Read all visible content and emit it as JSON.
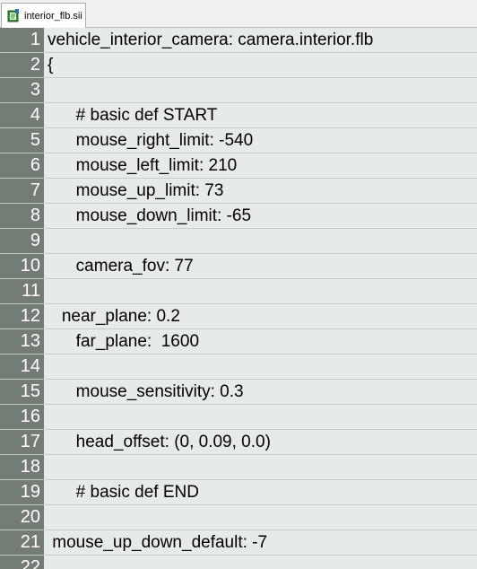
{
  "tab": {
    "icon": "notepad-file-icon",
    "label": "interior_flb.sii"
  },
  "colors": {
    "gutter": "#737d75",
    "editor_bg": "#e6ebe7",
    "line_separator": "#c3ccc5",
    "line_number_text": "#ffffff"
  },
  "lines": [
    {
      "num": "1",
      "text": "vehicle_interior_camera: camera.interior.flb"
    },
    {
      "num": "2",
      "text": "{"
    },
    {
      "num": "3",
      "text": ""
    },
    {
      "num": "4",
      "text": "      # basic def START"
    },
    {
      "num": "5",
      "text": "      mouse_right_limit: -540"
    },
    {
      "num": "6",
      "text": "      mouse_left_limit: 210"
    },
    {
      "num": "7",
      "text": "      mouse_up_limit: 73"
    },
    {
      "num": "8",
      "text": "      mouse_down_limit: -65"
    },
    {
      "num": "9",
      "text": ""
    },
    {
      "num": "10",
      "text": "      camera_fov: 77"
    },
    {
      "num": "11",
      "text": ""
    },
    {
      "num": "12",
      "text": "   near_plane: 0.2"
    },
    {
      "num": "13",
      "text": "      far_plane:  1600"
    },
    {
      "num": "14",
      "text": ""
    },
    {
      "num": "15",
      "text": "      mouse_sensitivity: 0.3"
    },
    {
      "num": "16",
      "text": ""
    },
    {
      "num": "17",
      "text": "      head_offset: (0, 0.09, 0.0)"
    },
    {
      "num": "18",
      "text": ""
    },
    {
      "num": "19",
      "text": "      # basic def END"
    },
    {
      "num": "20",
      "text": ""
    },
    {
      "num": "21",
      "text": " mouse_up_down_default: -7"
    },
    {
      "num": "22",
      "text": ""
    }
  ]
}
